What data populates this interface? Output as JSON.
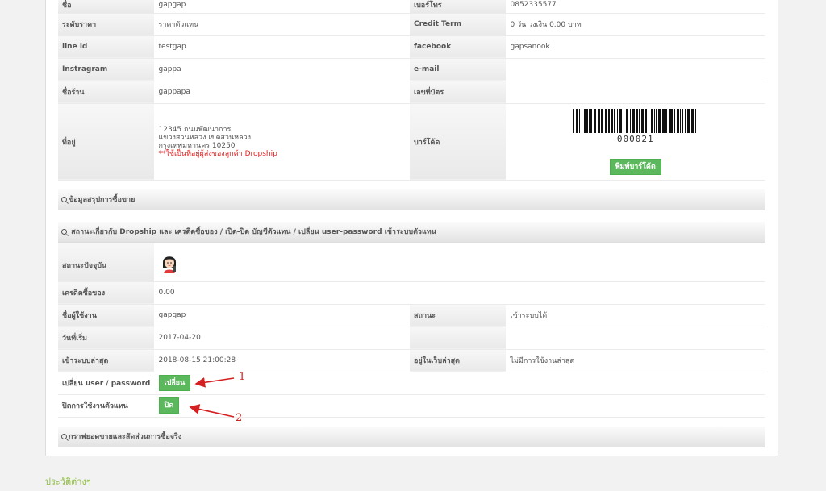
{
  "customer": {
    "name_label": "ชื่อ",
    "name": "gapgap",
    "phone_label": "เบอร์โทร",
    "phone": "0852335577",
    "price_level_label": "ระดับราคา",
    "price_level": "ราคาตัวแทน",
    "credit_term_label": "Credit Term",
    "credit_term": "0 วัน วงเงิน 0.00 บาท",
    "line_label": "line id",
    "line": "testgap",
    "facebook_label": "facebook",
    "facebook": "gapsanook",
    "instagram_label": "Instragram",
    "instagram": "gappa",
    "email_label": "e-mail",
    "email": "",
    "shop_label": "ชื่อร้าน",
    "shop": "gappapa",
    "idcard_label": "เลขที่บัตร",
    "idcard": "",
    "address_label": "ที่อยู่",
    "address_line1": "12345 ถนนพัฒนาการ",
    "address_line2": "แขวงสวนหลวง เขตสวนหลวง",
    "address_line3": "กรุงเทพมหานคร 10250",
    "address_note": "**ใช้เป็นที่อยู่ผู้ส่งของลูกค้า Dropship",
    "barcode_label": "บาร์โค้ด",
    "barcode_number": "000021",
    "print_barcode_button": "พิมพ์บาร์โค้ด"
  },
  "sections": {
    "sales_summary": "ข้อมูลสรุปการซื้อขาย",
    "dropship_status": "สถานะเกี่ยวกับ Dropship และ เครดิตซื้อของ / เปิด-ปิด บัญชีตัวแทน / เปลี่ยน user-password เข้าระบบตัวแทน",
    "sales_chart": "กราฟยอดขายและสัดส่วนการซื้อจริง"
  },
  "status": {
    "current_label": "สถานะปัจจุบัน",
    "credit_label": "เครดิตซื้อของ",
    "credit": "0.00",
    "username_label": "ชื่อผู้ใช้งาน",
    "username": "gapgap",
    "state_label": "สถานะ",
    "state": "เข้าระบบได้",
    "start_label": "วันที่เริ่ม",
    "start": "2017-04-20",
    "last_login_label": "เข้าระบบล่าสุด",
    "last_login": "2018-08-15 21:00:28",
    "last_web_label": "อยู่ในเว็บล่าสุด",
    "last_web": "ไม่มีการใช้งานล่าสุด",
    "change_pw_label": "เปลี่ยน user / password",
    "change_pw_button": "เปลี่ยน",
    "disable_label": "ปิดการใช้งานตัวแทน",
    "disable_button": "ปิด"
  },
  "annotations": {
    "one": "1",
    "two": "2"
  },
  "history_title": "ประวัติต่างๆ",
  "colors": {
    "button": "#5cb85c",
    "annotation": "#d42020",
    "history": "#8dbe3f"
  }
}
